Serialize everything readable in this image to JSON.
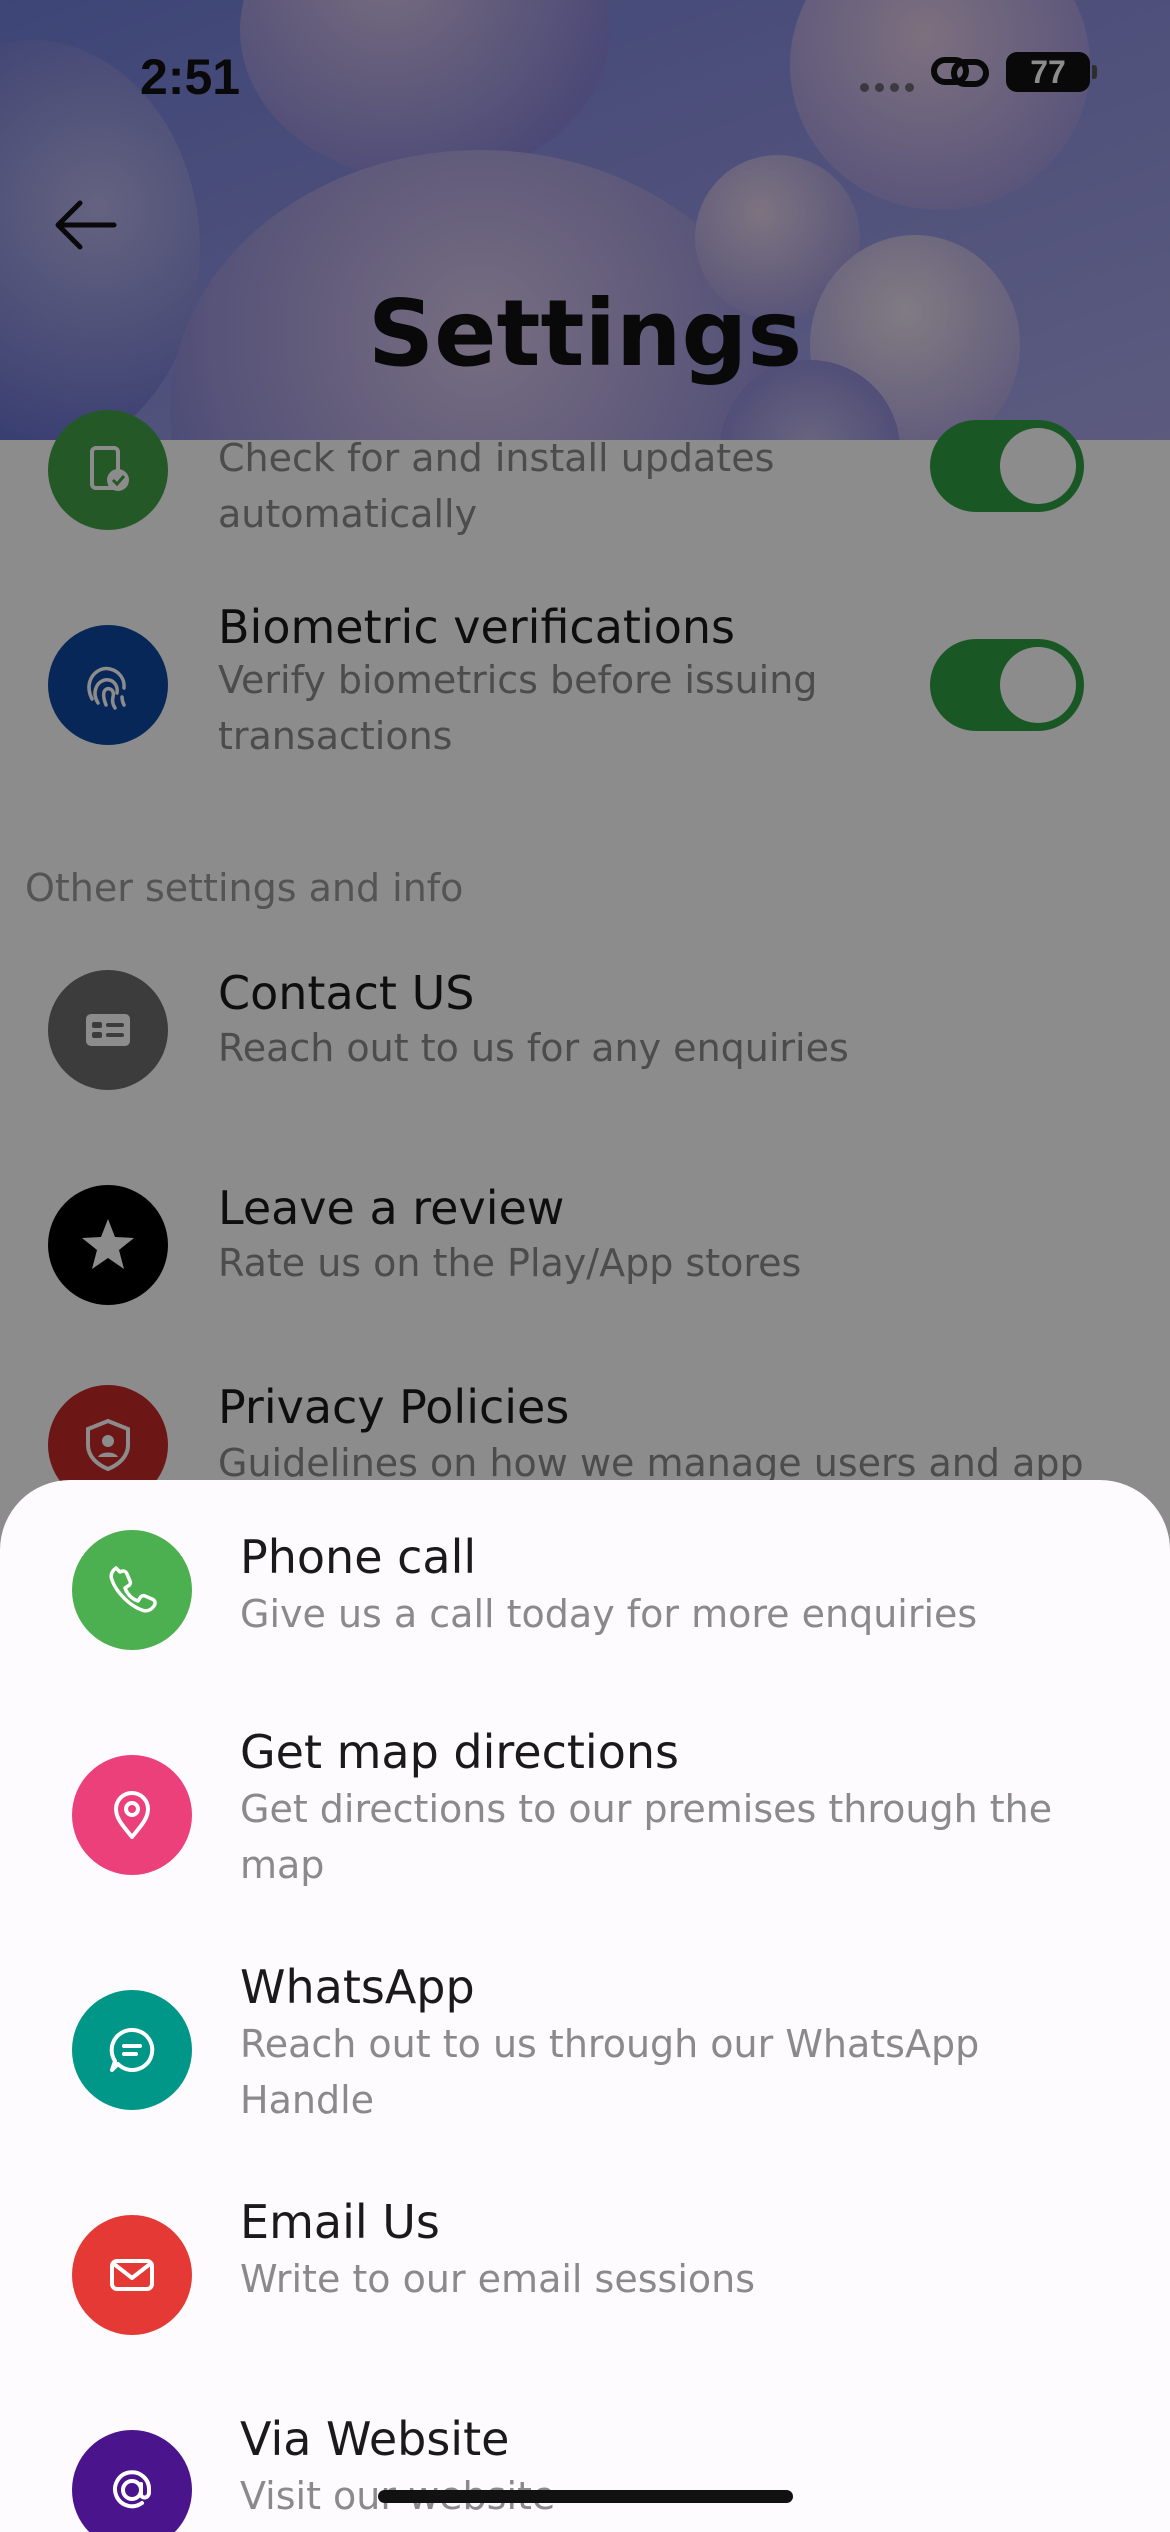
{
  "status_bar": {
    "time": "2:51",
    "battery": "77"
  },
  "header": {
    "title": "Settings"
  },
  "settings": {
    "auto_update": {
      "subtitle": "Check for and install updates automatically",
      "enabled": true
    },
    "biometric": {
      "title": "Biometric verifications",
      "subtitle": "Verify biometrics before issuing transactions",
      "enabled": true
    },
    "section_label": "Other settings and info",
    "contact": {
      "title": "Contact US",
      "subtitle": "Reach out to us for any enquiries"
    },
    "review": {
      "title": "Leave a review",
      "subtitle": "Rate us on the Play/App stores"
    },
    "privacy": {
      "title": "Privacy Policies",
      "subtitle": "Guidelines on how we manage users and app"
    }
  },
  "contact_sheet": {
    "options": [
      {
        "title": "Phone call",
        "subtitle": "Give us a call today for more enquiries",
        "icon": "phone-icon",
        "color": "#4caf50"
      },
      {
        "title": "Get map directions",
        "subtitle": "Get directions to our premises through the map",
        "icon": "map-pin-icon",
        "color": "#ec407a"
      },
      {
        "title": "WhatsApp",
        "subtitle": "Reach out to us through our WhatsApp Handle",
        "icon": "chat-bubble-icon",
        "color": "#009688"
      },
      {
        "title": "Email Us",
        "subtitle": "Write to our email sessions",
        "icon": "envelope-icon",
        "color": "#e53935"
      },
      {
        "title": "Via Website",
        "subtitle": "Visit our website",
        "icon": "at-sign-icon",
        "color": "#4a148c"
      }
    ]
  }
}
